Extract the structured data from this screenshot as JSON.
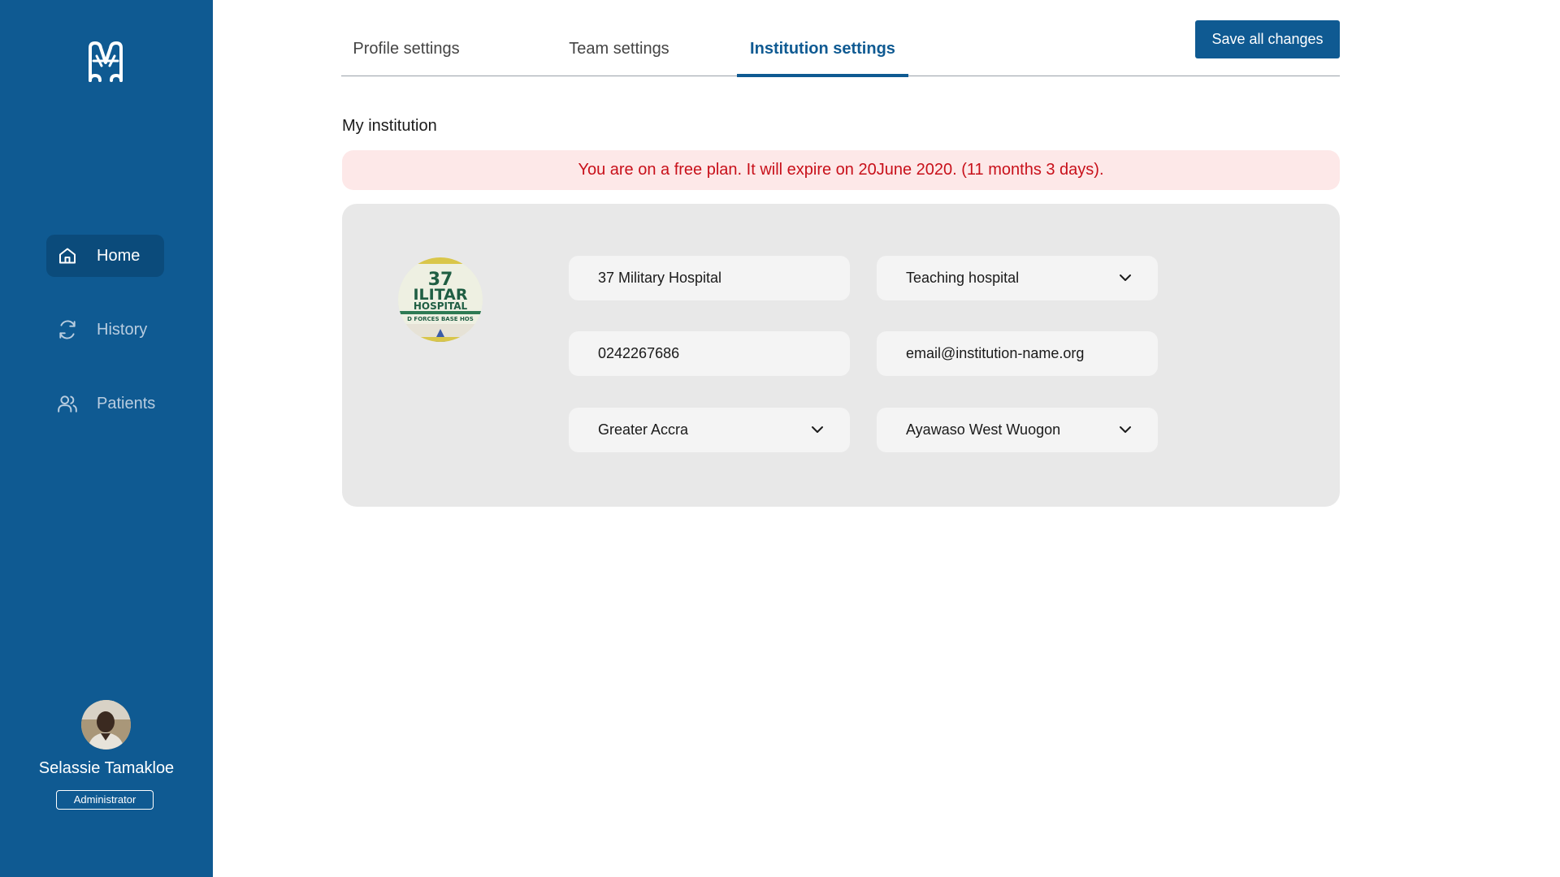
{
  "sidebar": {
    "logo_icon": "medical-logo-icon",
    "items": [
      {
        "label": "Home",
        "icon": "home-icon",
        "active": true
      },
      {
        "label": "History",
        "icon": "refresh-icon",
        "active": false
      },
      {
        "label": "Patients",
        "icon": "users-icon",
        "active": false
      }
    ],
    "user": {
      "name": "Selassie Tamakloe",
      "role": "Administrator"
    }
  },
  "tabs": [
    {
      "label": "Profile settings",
      "active": false
    },
    {
      "label": "Team settings",
      "active": false
    },
    {
      "label": "Institution settings",
      "active": true
    }
  ],
  "toolbar": {
    "save_label": "Save all changes"
  },
  "institution": {
    "section_title": "My institution",
    "plan_notice": "You are on a free plan. It will expire on 20June 2020. (11 months 3 days).",
    "logo_text": {
      "line1": "37",
      "line2": "ILITAR",
      "line3": "HOSPITAL",
      "line4": "D FORCES BASE HOS"
    },
    "name": "37 Military Hospital",
    "type": "Teaching hospital",
    "phone": "0242267686",
    "email": "email@institution-name.org",
    "region": "Greater Accra",
    "district": "Ayawaso West Wuogon"
  },
  "colors": {
    "brand": "#0f5a92",
    "brand_dark": "#0b4b7b",
    "warning_text": "#c8101a",
    "warning_bg": "#fde8e8",
    "card_bg": "#e8e8e8"
  }
}
